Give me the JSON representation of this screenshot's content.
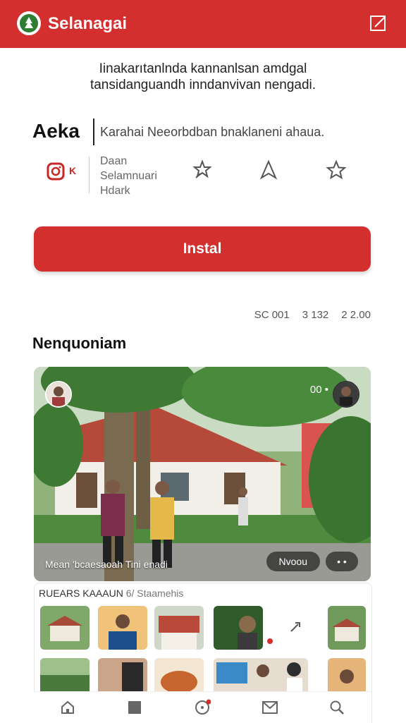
{
  "app": {
    "title": "Selanagai"
  },
  "headline": {
    "line1": "Iinakarıtanlnda kannanlsan amdgal",
    "line2": "tansidanguandh inndanvivan nengadi."
  },
  "brand": {
    "name": "Aeka",
    "description": "Karahai Neeorbdban bnaklaneni ahaua."
  },
  "info": {
    "mini_label": "K",
    "lines": [
      "Daan",
      "Selamnuari",
      "Hdark"
    ]
  },
  "install": {
    "label": "Instal"
  },
  "stats": [
    "SC 001",
    "3 132",
    "2 2.00"
  ],
  "section": {
    "title": "Nenquoniam"
  },
  "photo": {
    "caption": "Mean 'bcaesaoah Tini enadi",
    "pill_label": "Nvoou",
    "more_label": "• •",
    "top_icons": "00 •"
  },
  "gallery": {
    "header_bold": "RUEARS KAAAUN",
    "header_muted": "6/ Staamehis"
  },
  "nav": [
    "home-icon",
    "square-icon",
    "circle-icon",
    "mail-icon",
    "search-icon"
  ],
  "colors": {
    "accent": "#d32f2f",
    "text": "#222222"
  }
}
